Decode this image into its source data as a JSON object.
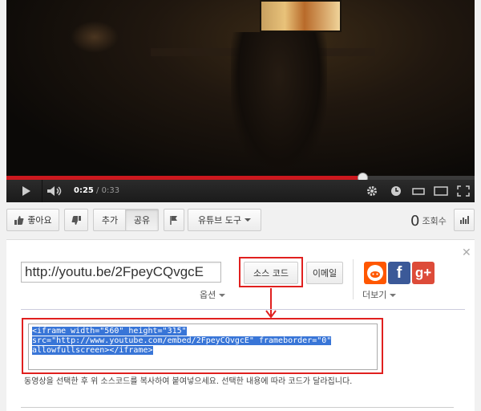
{
  "player": {
    "current_time": "0:25",
    "separator": " / ",
    "duration": "0:33",
    "progress": 0.76
  },
  "actions": {
    "like_label": "좋아요",
    "add_label": "추가",
    "share_label": "공유",
    "tools_label": "유튜브 도구",
    "view_count": "0",
    "view_label": "조회수"
  },
  "share": {
    "short_url": "http://youtu.be/2FpeyCQvgcE",
    "options_label": "옵션",
    "embed_tab_label": "소스 코드",
    "email_tab_label": "이메일",
    "more_label": "더보기",
    "gplus_label": "g+",
    "facebook_label": "f",
    "embed_code_lines": [
      "<iframe width=\"560\" height=\"315\"",
      "src=\"http://www.youtube.com/embed/2FpeyCQvgcE\" frameborder=\"0\"",
      "allowfullscreen></iframe>"
    ],
    "help_text": "동영상을 선택한 후 위 소스코드를 복사하여 붙여넣으세요. 선택한 내용에 따라 코드가 달라집니다."
  },
  "colors": {
    "progress": "#cc181e",
    "highlight": "#e0201f",
    "selection": "#3875d7",
    "facebook": "#3b5998",
    "gplus": "#dd4b39",
    "reddit": "#ff5700"
  }
}
